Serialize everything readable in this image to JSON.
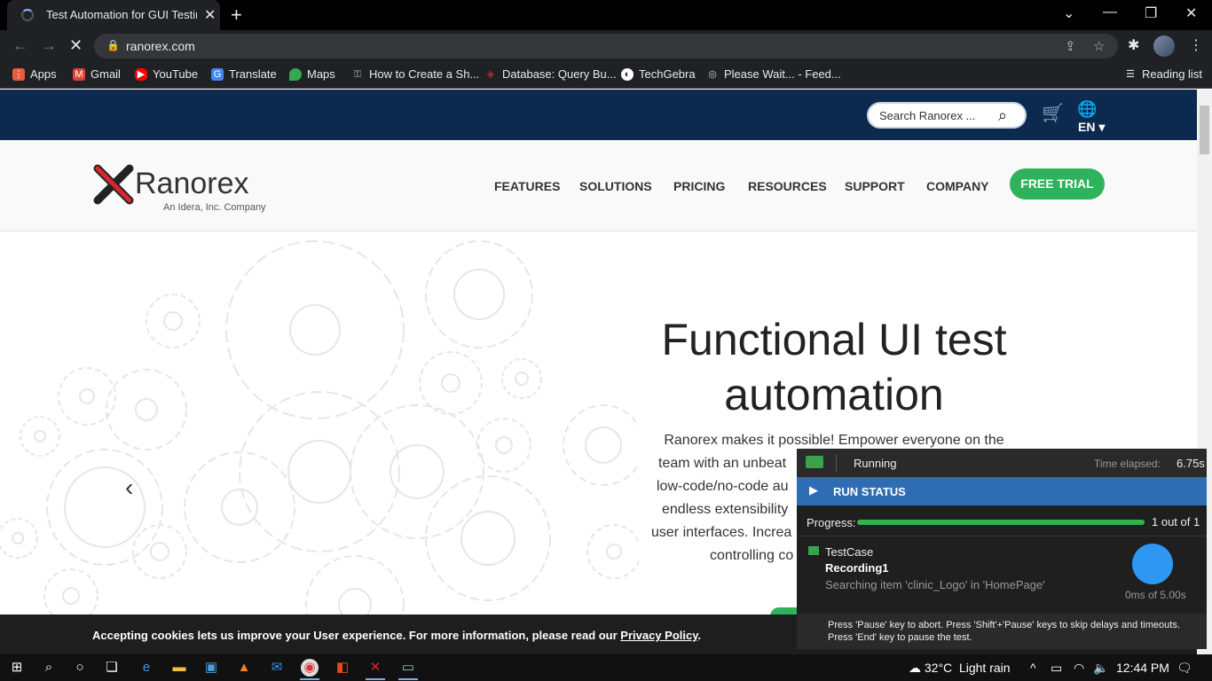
{
  "browser": {
    "tab_title": "Test Automation for GUI Testing",
    "url": "ranorex.com"
  },
  "bookmarks": {
    "items": [
      {
        "label": "Apps",
        "icon": "apps-grid-icon",
        "color": "#e85b3c"
      },
      {
        "label": "Gmail",
        "icon": "gmail-icon",
        "color": "#e34133"
      },
      {
        "label": "YouTube",
        "icon": "youtube-icon",
        "color": "#ff0000"
      },
      {
        "label": "Translate",
        "icon": "translate-icon",
        "color": "#4285f4"
      },
      {
        "label": "Maps",
        "icon": "maps-icon",
        "color": "#34a853"
      },
      {
        "label": "How to Create a Sh...",
        "icon": "key-icon",
        "color": "#bbbbbb"
      },
      {
        "label": "Database: Query Bu...",
        "icon": "database-icon",
        "color": "#b03030"
      },
      {
        "label": "TechGebra",
        "icon": "techgebra-icon",
        "color": "#ffffff"
      },
      {
        "label": "Please Wait... - Feed...",
        "icon": "feed-icon",
        "color": "#cccccc"
      }
    ],
    "reading_list": "Reading list"
  },
  "site": {
    "search_placeholder": "Search Ranorex ...",
    "language": "EN",
    "logo_text": "Ranorex",
    "logo_subtitle": "An Idera, Inc. Company",
    "nav": [
      "FEATURES",
      "SOLUTIONS",
      "PRICING",
      "RESOURCES",
      "SUPPORT",
      "COMPANY"
    ],
    "free_trial": "FREE TRIAL",
    "hero_title_line1": "Functional UI test",
    "hero_title_line2": "automation",
    "hero_lines": [
      "Ranorex makes it possible! Empower everyone on the",
      "team with an unbeat",
      "low-code/no-code au",
      "endless extensibility",
      "user interfaces. Increa",
      "controlling co"
    ],
    "cookie_text": "Accepting cookies lets us improve your User experience. For more information, please read our ",
    "cookie_link": "Privacy Policy",
    "cookie_period": ".",
    "accent_green": "#2fb25c",
    "header_navy": "#0c2a4f"
  },
  "run_status": {
    "state": "Running",
    "time_label": "Time elapsed:",
    "time_value": "6.75s",
    "section": "RUN STATUS",
    "progress_label": "Progress:",
    "progress_fraction": 1.0,
    "progress_count": "1 out of 1",
    "testcase": "TestCase",
    "recording": "Recording1",
    "searching": "Searching item 'clinic_Logo' in 'HomePage'",
    "timer": "0ms of 5.00s",
    "note_line1": "Press 'Pause' key to abort. Press 'Shift'+'Pause' keys to skip delays and timeouts.",
    "note_line2": "Press 'End' key to pause the test."
  },
  "taskbar": {
    "weather": "32°C",
    "weather_desc": "Light rain",
    "time": "12:44 PM"
  }
}
